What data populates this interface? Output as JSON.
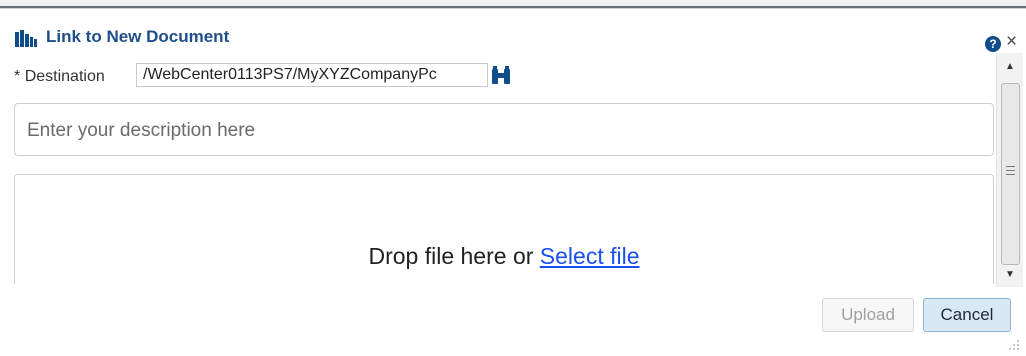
{
  "dialog": {
    "title": "Link to New Document",
    "help_glyph": "?",
    "close_glyph": "×"
  },
  "destination": {
    "required_marker": "*",
    "label": "Destination",
    "value": "/WebCenter0113PS7/MyXYZCompanyPc"
  },
  "description": {
    "placeholder": "Enter your description here"
  },
  "dropzone": {
    "text": "Drop file here or",
    "link_label": "Select file"
  },
  "scrollbar": {
    "up_glyph": "▲",
    "down_glyph": "▼"
  },
  "buttons": {
    "upload_label": "Upload",
    "cancel_label": "Cancel"
  },
  "colors": {
    "title": "#1f4f8a",
    "link": "#1a4ff0",
    "icon_blue": "#0f4c89"
  },
  "icons": {
    "title_icon": "library-books-icon",
    "browse_icon": "binoculars-icon",
    "help_icon": "help-icon",
    "close_icon": "close-icon"
  }
}
